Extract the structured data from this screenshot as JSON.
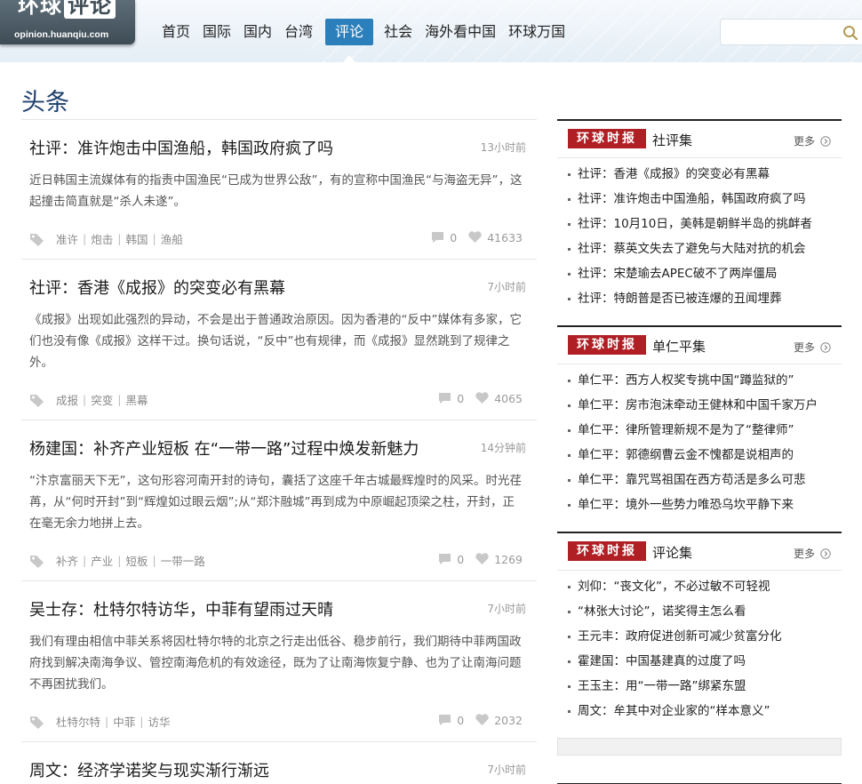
{
  "header": {
    "logo_text": "环球评论",
    "logo_url": "opinion.huanqiu.com",
    "nav": [
      "首页",
      "国际",
      "国内",
      "台湾",
      "评论",
      "社会",
      "海外看中国",
      "环球万国"
    ],
    "active_nav": "评论",
    "search_placeholder": ""
  },
  "main": {
    "section_title": "头条",
    "articles": [
      {
        "title": "社评：准许炮击中国渔船，韩国政府疯了吗",
        "time": "13小时前",
        "summary": "近日韩国主流媒体有的指责中国渔民“已成为世界公敌”，有的宣称中国渔民“与海盗无异”，这起撞击简直就是“杀人未遂”。",
        "tags": [
          "准许",
          "炮击",
          "韩国",
          "渔船"
        ],
        "comments": "0",
        "likes": "41633"
      },
      {
        "title": "社评：香港《成报》的突变必有黑幕",
        "time": "7小时前",
        "summary": "《成报》出现如此强烈的异动，不会是出于普通政治原因。因为香港的“反中”媒体有多家，它们也没有像《成报》这样干过。换句话说，“反中”也有规律，而《成报》显然跳到了规律之外。",
        "tags": [
          "成报",
          "突变",
          "黑幕"
        ],
        "comments": "0",
        "likes": "4065"
      },
      {
        "title": "杨建国：补齐产业短板 在“一带一路”过程中焕发新魅力",
        "time": "14分钟前",
        "summary": "“汴京富丽天下无”，这句形容河南开封的诗句，囊括了这座千年古城最辉煌时的风采。时光荏苒，从“何时开封”到“辉煌如过眼云烟”;从“郑汴融城”再到成为中原崛起顶梁之柱，开封，正在毫无余力地拼上去。",
        "tags": [
          "补齐",
          "产业",
          "短板",
          "一带一路"
        ],
        "comments": "0",
        "likes": "1269"
      },
      {
        "title": "吴士存：杜特尔特访华，中菲有望雨过天晴",
        "time": "7小时前",
        "summary": "我们有理由相信中菲关系将因杜特尔特的北京之行走出低谷、稳步前行，我们期待中菲两国政府找到解决南海争议、管控南海危机的有效途径，既为了让南海恢复宁静、也为了让南海问题不再困扰我们。",
        "tags": [
          "杜特尔特",
          "中菲",
          "访华"
        ],
        "comments": "0",
        "likes": "2032"
      },
      {
        "title": "周文：经济学诺奖与现实渐行渐远",
        "time": "7小时前",
        "summary": "",
        "tags": [],
        "comments": "",
        "likes": ""
      }
    ]
  },
  "sidebar": {
    "brand": "环球时报",
    "more_label": "更多",
    "boxes": [
      {
        "title": "社评集",
        "items": [
          "社评：香港《成报》的突变必有黑幕",
          "社评：准许炮击中国渔船，韩国政府疯了吗",
          "社评：10月10日，美韩是朝鲜半岛的挑衅者",
          "社评：蔡英文失去了避免与大陆对抗的机会",
          "社评：宋楚瑜去APEC破不了两岸僵局",
          "社评：特朗普是否已被连爆的丑闻埋葬"
        ]
      },
      {
        "title": "单仁平集",
        "items": [
          "单仁平：西方人权奖专挑中国“蹲监狱的”",
          "单仁平：房市泡沫牵动王健林和中国千家万户",
          "单仁平：律所管理新规不是为了“整律师”",
          "单仁平：郭德纲曹云金不愧都是说相声的",
          "单仁平：靠咒骂祖国在西方苟活是多么可悲",
          "单仁平：境外一些势力唯恐乌坎平静下来"
        ]
      },
      {
        "title": "评论集",
        "items": [
          "刘仰：“丧文化”，不必过敏不可轻视",
          "“林张大讨论”，诺奖得主怎么看",
          "王元丰：政府促进创新可减少贫富分化",
          "霍建国：中国基建真的过度了吗",
          "王玉主：用“一带一路”绑紧东盟",
          "周文：牟其中对企业家的“样本意义”"
        ]
      }
    ]
  }
}
